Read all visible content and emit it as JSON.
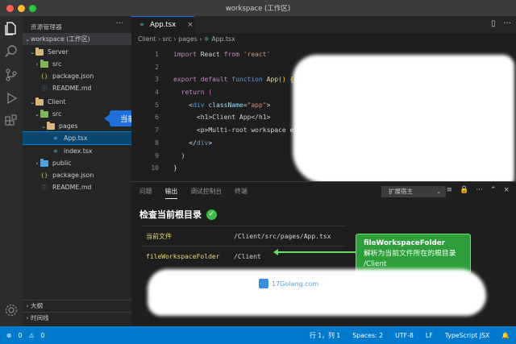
{
  "window": {
    "title": "workspace (工作区)"
  },
  "activity_bar": {
    "icons": [
      "files-icon",
      "search-icon",
      "source-control-icon",
      "run-debug-icon",
      "extensions-icon",
      "settings-gear-icon"
    ]
  },
  "sidebar": {
    "header": "资源管理器",
    "more": "···",
    "tree": [
      {
        "label": "workspace (工作区)",
        "depth": 0,
        "type": "root"
      },
      {
        "label": "Server",
        "depth": 1,
        "type": "folder",
        "open": true
      },
      {
        "label": "src",
        "depth": 2,
        "type": "folder-green",
        "open": false
      },
      {
        "label": "package.json",
        "depth": 2,
        "type": "json"
      },
      {
        "label": "README.md",
        "depth": 2,
        "type": "info"
      },
      {
        "label": "Client",
        "depth": 1,
        "type": "folder",
        "open": true
      },
      {
        "label": "src",
        "depth": 2,
        "type": "folder-green",
        "open": true
      },
      {
        "label": "pages",
        "depth": 3,
        "type": "folder",
        "open": true
      },
      {
        "label": "App.tsx",
        "depth": 4,
        "type": "react",
        "active": true
      },
      {
        "label": "index.tsx",
        "depth": 4,
        "type": "react"
      },
      {
        "label": "public",
        "depth": 2,
        "type": "folder-blue",
        "open": false
      },
      {
        "label": "package.json",
        "depth": 2,
        "type": "json"
      },
      {
        "label": "README.md",
        "depth": 2,
        "type": "info"
      }
    ],
    "sections": [
      "大纲",
      "时间线"
    ]
  },
  "callout_current_file": "当前文件",
  "editor": {
    "tab_label": "App.tsx",
    "breadcrumb": [
      "Client",
      "src",
      "pages",
      "App.tsx"
    ],
    "line_numbers": [
      "1",
      "2",
      "3",
      "4",
      "5",
      "6",
      "7",
      "8",
      "9",
      "10"
    ],
    "code": {
      "l1_kw": "import",
      "l1_ident": " React ",
      "l1_from": "from",
      "l1_str": "'react'",
      "l3_export": "export",
      "l3_default": "default",
      "l3_function": "function",
      "l3_name": "App",
      "l3_paren": "() {",
      "l4_return": "  return",
      "l4_paren": " (",
      "l5_a": "    <",
      "l5_tag": "div",
      "l5_attr": " className",
      "l5_eq": "=",
      "l5_val": "\"app\"",
      "l5_b": ">",
      "l6": "      <h1>Client App</h1>",
      "l7": "      <p>Multi-root workspace example</p>",
      "l8_a": "    </",
      "l8_tag": "div",
      "l8_b": ">",
      "l9": "  )",
      "l10": "}"
    }
  },
  "panel": {
    "tabs": [
      "问题",
      "输出",
      "调试控制台",
      "终端"
    ],
    "active_tab": "输出",
    "channel": "扩展宿主",
    "title": "检查当前根目录",
    "rows": [
      {
        "key": "当前文件",
        "value": "/Client/src/pages/App.tsx"
      },
      {
        "key": "fileWorkspaceFolder",
        "value": "/Client"
      }
    ],
    "callout": {
      "line1": "fileWorkspaceFolder",
      "line2": "解析为当前文件所在的根目录",
      "line3": "/Client"
    },
    "watermark": "17Golang.com"
  },
  "status_bar": {
    "errors": "0",
    "warnings": "0",
    "position": "行 1，列 1",
    "spaces": "Spaces: 2",
    "encoding": "UTF-8",
    "eol": "LF",
    "language": "TypeScript JSX"
  }
}
